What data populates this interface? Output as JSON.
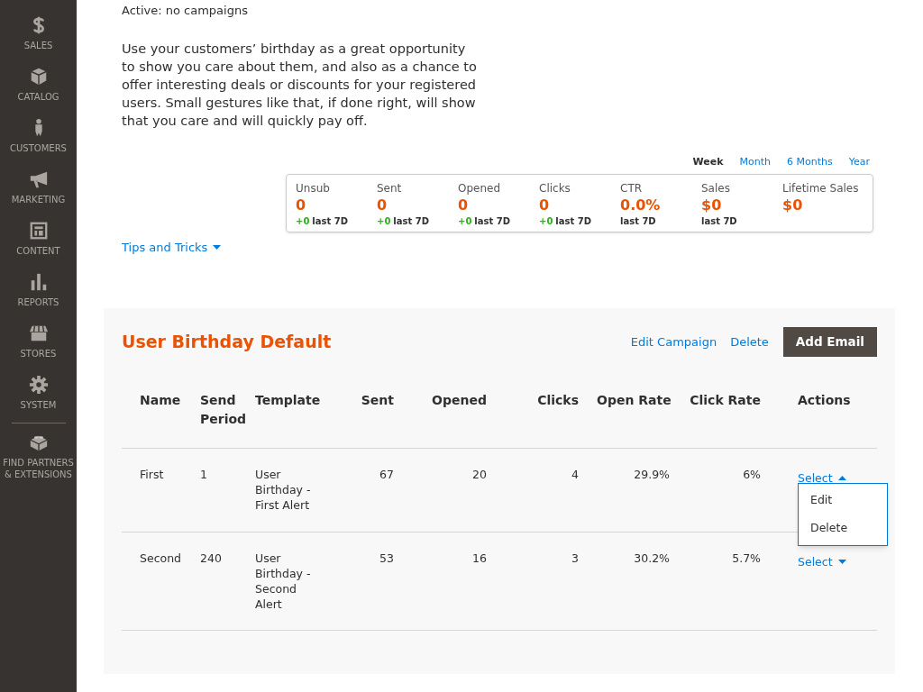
{
  "sidebar": {
    "items": [
      {
        "label": "SALES"
      },
      {
        "label": "CATALOG"
      },
      {
        "label": "CUSTOMERS"
      },
      {
        "label": "MARKETING"
      },
      {
        "label": "CONTENT"
      },
      {
        "label": "REPORTS"
      },
      {
        "label": "STORES"
      },
      {
        "label": "SYSTEM"
      },
      {
        "label": "FIND PARTNERS & EXTENSIONS"
      }
    ]
  },
  "status": "Active: no campaigns",
  "description": "Use your customers’ birthday as a great opportunity to show you care about them, and also as a chance to offer interesting deals or discounts for your registered users. Small gestures like that, if done right, will show that you care and will quickly pay off.",
  "periods": [
    {
      "label": "Week",
      "selected": true
    },
    {
      "label": "Month",
      "selected": false
    },
    {
      "label": "6 Months",
      "selected": false
    },
    {
      "label": "Year",
      "selected": false
    }
  ],
  "stats": [
    {
      "label": "Unsub",
      "value": "0",
      "delta": "+0",
      "note": "last 7D"
    },
    {
      "label": "Sent",
      "value": "0",
      "delta": "+0",
      "note": "last 7D"
    },
    {
      "label": "Opened",
      "value": "0",
      "delta": "+0",
      "note": "last 7D"
    },
    {
      "label": "Clicks",
      "value": "0",
      "delta": "+0",
      "note": "last 7D"
    },
    {
      "label": "CTR",
      "value": "0.0%",
      "note": "last 7D"
    },
    {
      "label": "Sales",
      "value": "$0",
      "note": "last 7D"
    },
    {
      "label": "Lifetime Sales",
      "value": "$0"
    }
  ],
  "tips_link": "Tips and Tricks",
  "campaign": {
    "title": "User Birthday Default",
    "links": [
      "Edit Campaign",
      "Delete"
    ],
    "add_button": "Add Email",
    "columns": [
      "Name",
      "Send Period",
      "Template",
      "Sent",
      "Opened",
      "Clicks",
      "Open Rate",
      "Click Rate",
      "Actions"
    ],
    "rows": [
      {
        "name": "First",
        "period": "1",
        "template": "User Birthday - First Alert",
        "sent": "67",
        "opened": "20",
        "clicks": "4",
        "open_rate": "29.9%",
        "click_rate": "6%",
        "action": "Select",
        "expanded": true,
        "menu": [
          "Edit",
          "Delete"
        ]
      },
      {
        "name": "Second",
        "period": "240",
        "template": "User Birthday - Second Alert",
        "sent": "53",
        "opened": "16",
        "clicks": "3",
        "open_rate": "30.2%",
        "click_rate": "5.7%",
        "action": "Select",
        "expanded": false
      }
    ]
  }
}
